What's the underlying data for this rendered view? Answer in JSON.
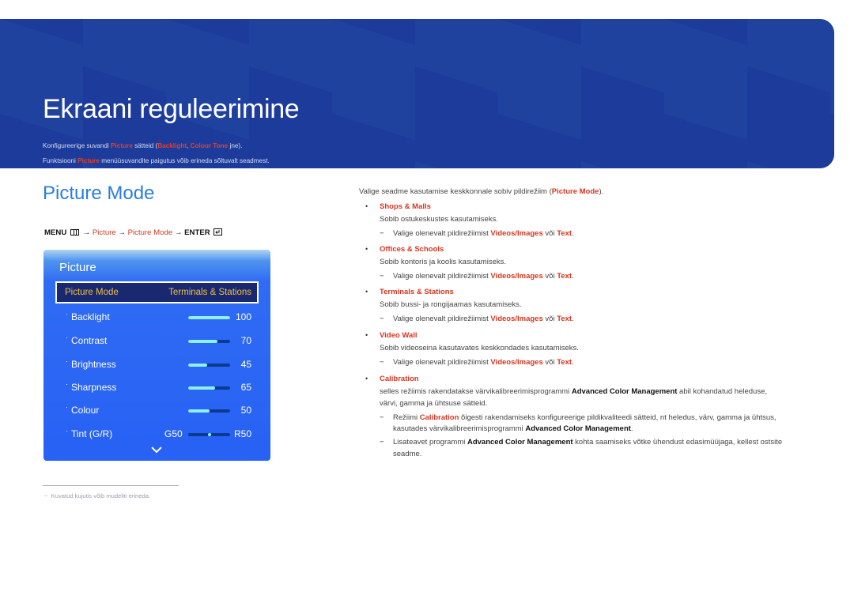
{
  "banner": {
    "title": "Ekraani reguleerimine",
    "line1": {
      "pre": "Konfigureerige suvandi ",
      "hl1": "Picture",
      "mid": " sätteid (",
      "hl2": "Backlight",
      "sep": ", ",
      "hl3": "Colour Tone",
      "post": " jne)."
    },
    "line2": {
      "pre": "Funktsiooni ",
      "hl": "Picture",
      "post": " menüüsuvandite paigutus võib erineda sõltuvalt seadmest."
    }
  },
  "section": {
    "title": "Picture Mode",
    "menu_path": {
      "menu": "MENU",
      "arrow": "→",
      "step1": "Picture",
      "step2": "Picture Mode",
      "enter": "ENTER"
    }
  },
  "osd": {
    "title": "Picture",
    "selected": {
      "label": "Picture Mode",
      "value": "Terminals & Stations"
    },
    "rows": [
      {
        "label": "Backlight",
        "value": "100",
        "level": 100
      },
      {
        "label": "Contrast",
        "value": "70",
        "level": 70
      },
      {
        "label": "Brightness",
        "value": "45",
        "level": 45
      },
      {
        "label": "Sharpness",
        "value": "65",
        "level": 65
      },
      {
        "label": "Colour",
        "value": "50",
        "level": 50
      }
    ],
    "tint": {
      "label": "Tint (G/R)",
      "left": "G50",
      "right": "R50",
      "position": 50
    },
    "bullet": "·"
  },
  "footnote": "Kuvatud kujutis võib mudeliti erineda.",
  "right": {
    "intro": {
      "pre": "Valige seadme kasutamise keskkonnale sobiv pildirežiim (",
      "hl": "Picture Mode",
      "post": ")."
    },
    "note": {
      "pre": "Valige olenevalt pildirežiimist ",
      "hl1": "Videos/Images",
      "mid": " või ",
      "hl2": "Text",
      "post": "."
    },
    "items": [
      {
        "title": "Shops & Malls",
        "desc": "Sobib ostukeskustes kasutamiseks."
      },
      {
        "title": "Offices & Schools",
        "desc": "Sobib kontoris ja koolis kasutamiseks."
      },
      {
        "title": "Terminals & Stations",
        "desc": "Sobib bussi- ja rongijaamas kasutamiseks."
      },
      {
        "title": "Video Wall",
        "desc": "Sobib videoseina kasutavates keskkondades kasutamiseks."
      }
    ],
    "calibration": {
      "title": "Calibration",
      "desc1": {
        "pre": "selles režiimis rakendatakse värvikalibreerimisprogrammi ",
        "b": "Advanced Color Management",
        "post": " abil kohandatud heleduse,"
      },
      "desc2": "värvi, gamma ja ühtsuse sätteid.",
      "note1a": {
        "pre": "Režiimi ",
        "hl": "Calibration",
        "post": " õigesti rakendamiseks konfigureerige pildikvaliteedi sätteid, nt heledus, värv, gamma ja ühtsus,"
      },
      "note1b": {
        "pre": "kasutades värvikalibreerimisprogrammi ",
        "b": "Advanced Color Management",
        "post": "."
      },
      "note2a": {
        "pre": "Lisateavet programmi ",
        "b": "Advanced Color Management",
        "post": " kohta saamiseks võtke ühendust edasimüüjaga, kellest ostsite"
      },
      "note2b": "seadme."
    },
    "bullet": "•",
    "dash": "−"
  }
}
